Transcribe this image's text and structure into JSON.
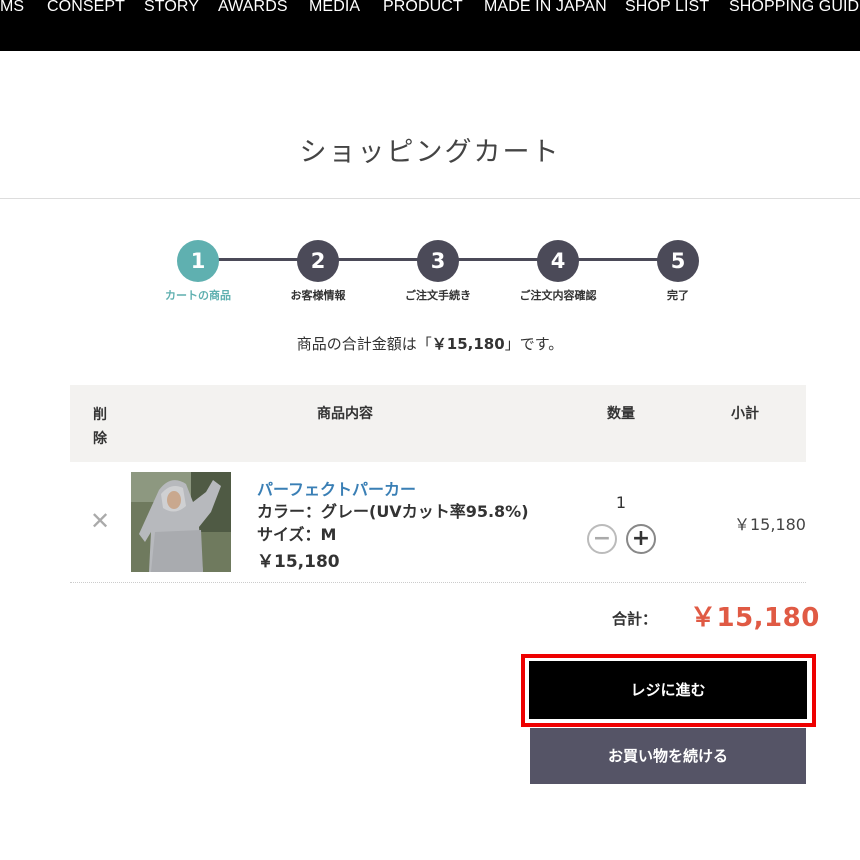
{
  "nav": {
    "items": [
      "MS",
      "CONSEPT",
      "STORY",
      "AWARDS",
      "MEDIA",
      "PRODUCT",
      "MADE IN JAPAN",
      "SHOP LIST",
      "SHOPPING GUID"
    ]
  },
  "page": {
    "title": "ショッピングカート"
  },
  "steps": [
    {
      "number": "1",
      "label": "カートの商品",
      "active": true
    },
    {
      "number": "2",
      "label": "お客様情報"
    },
    {
      "number": "3",
      "label": "ご注文手続き"
    },
    {
      "number": "4",
      "label": "ご注文内容確認"
    },
    {
      "number": "5",
      "label": "完了"
    }
  ],
  "summary": {
    "prefix": "商品の合計金額は「",
    "amount": "￥15,180",
    "suffix": "」です。"
  },
  "table": {
    "headers": {
      "delete": "削除",
      "product": "商品内容",
      "quantity": "数量",
      "subtotal": "小計"
    },
    "rows": [
      {
        "name": "パーフェクトパーカー",
        "color": "カラー：グレー(UVカット率95.8%)",
        "size": "サイズ：M",
        "price": "￥15,180",
        "quantity": "1",
        "subtotal": "￥15,180",
        "remove_symbol": "✕"
      }
    ]
  },
  "totals": {
    "label": "合計：",
    "value": "￥15,180"
  },
  "buttons": {
    "checkout": "レジに進む",
    "continue": "お買い物を続ける"
  },
  "colors": {
    "accent_teal": "#5fb0b0",
    "step_dark": "#4b4a58",
    "price_red": "#e05a44",
    "link_blue": "#3a7fb5",
    "highlight": "#ee0000"
  }
}
